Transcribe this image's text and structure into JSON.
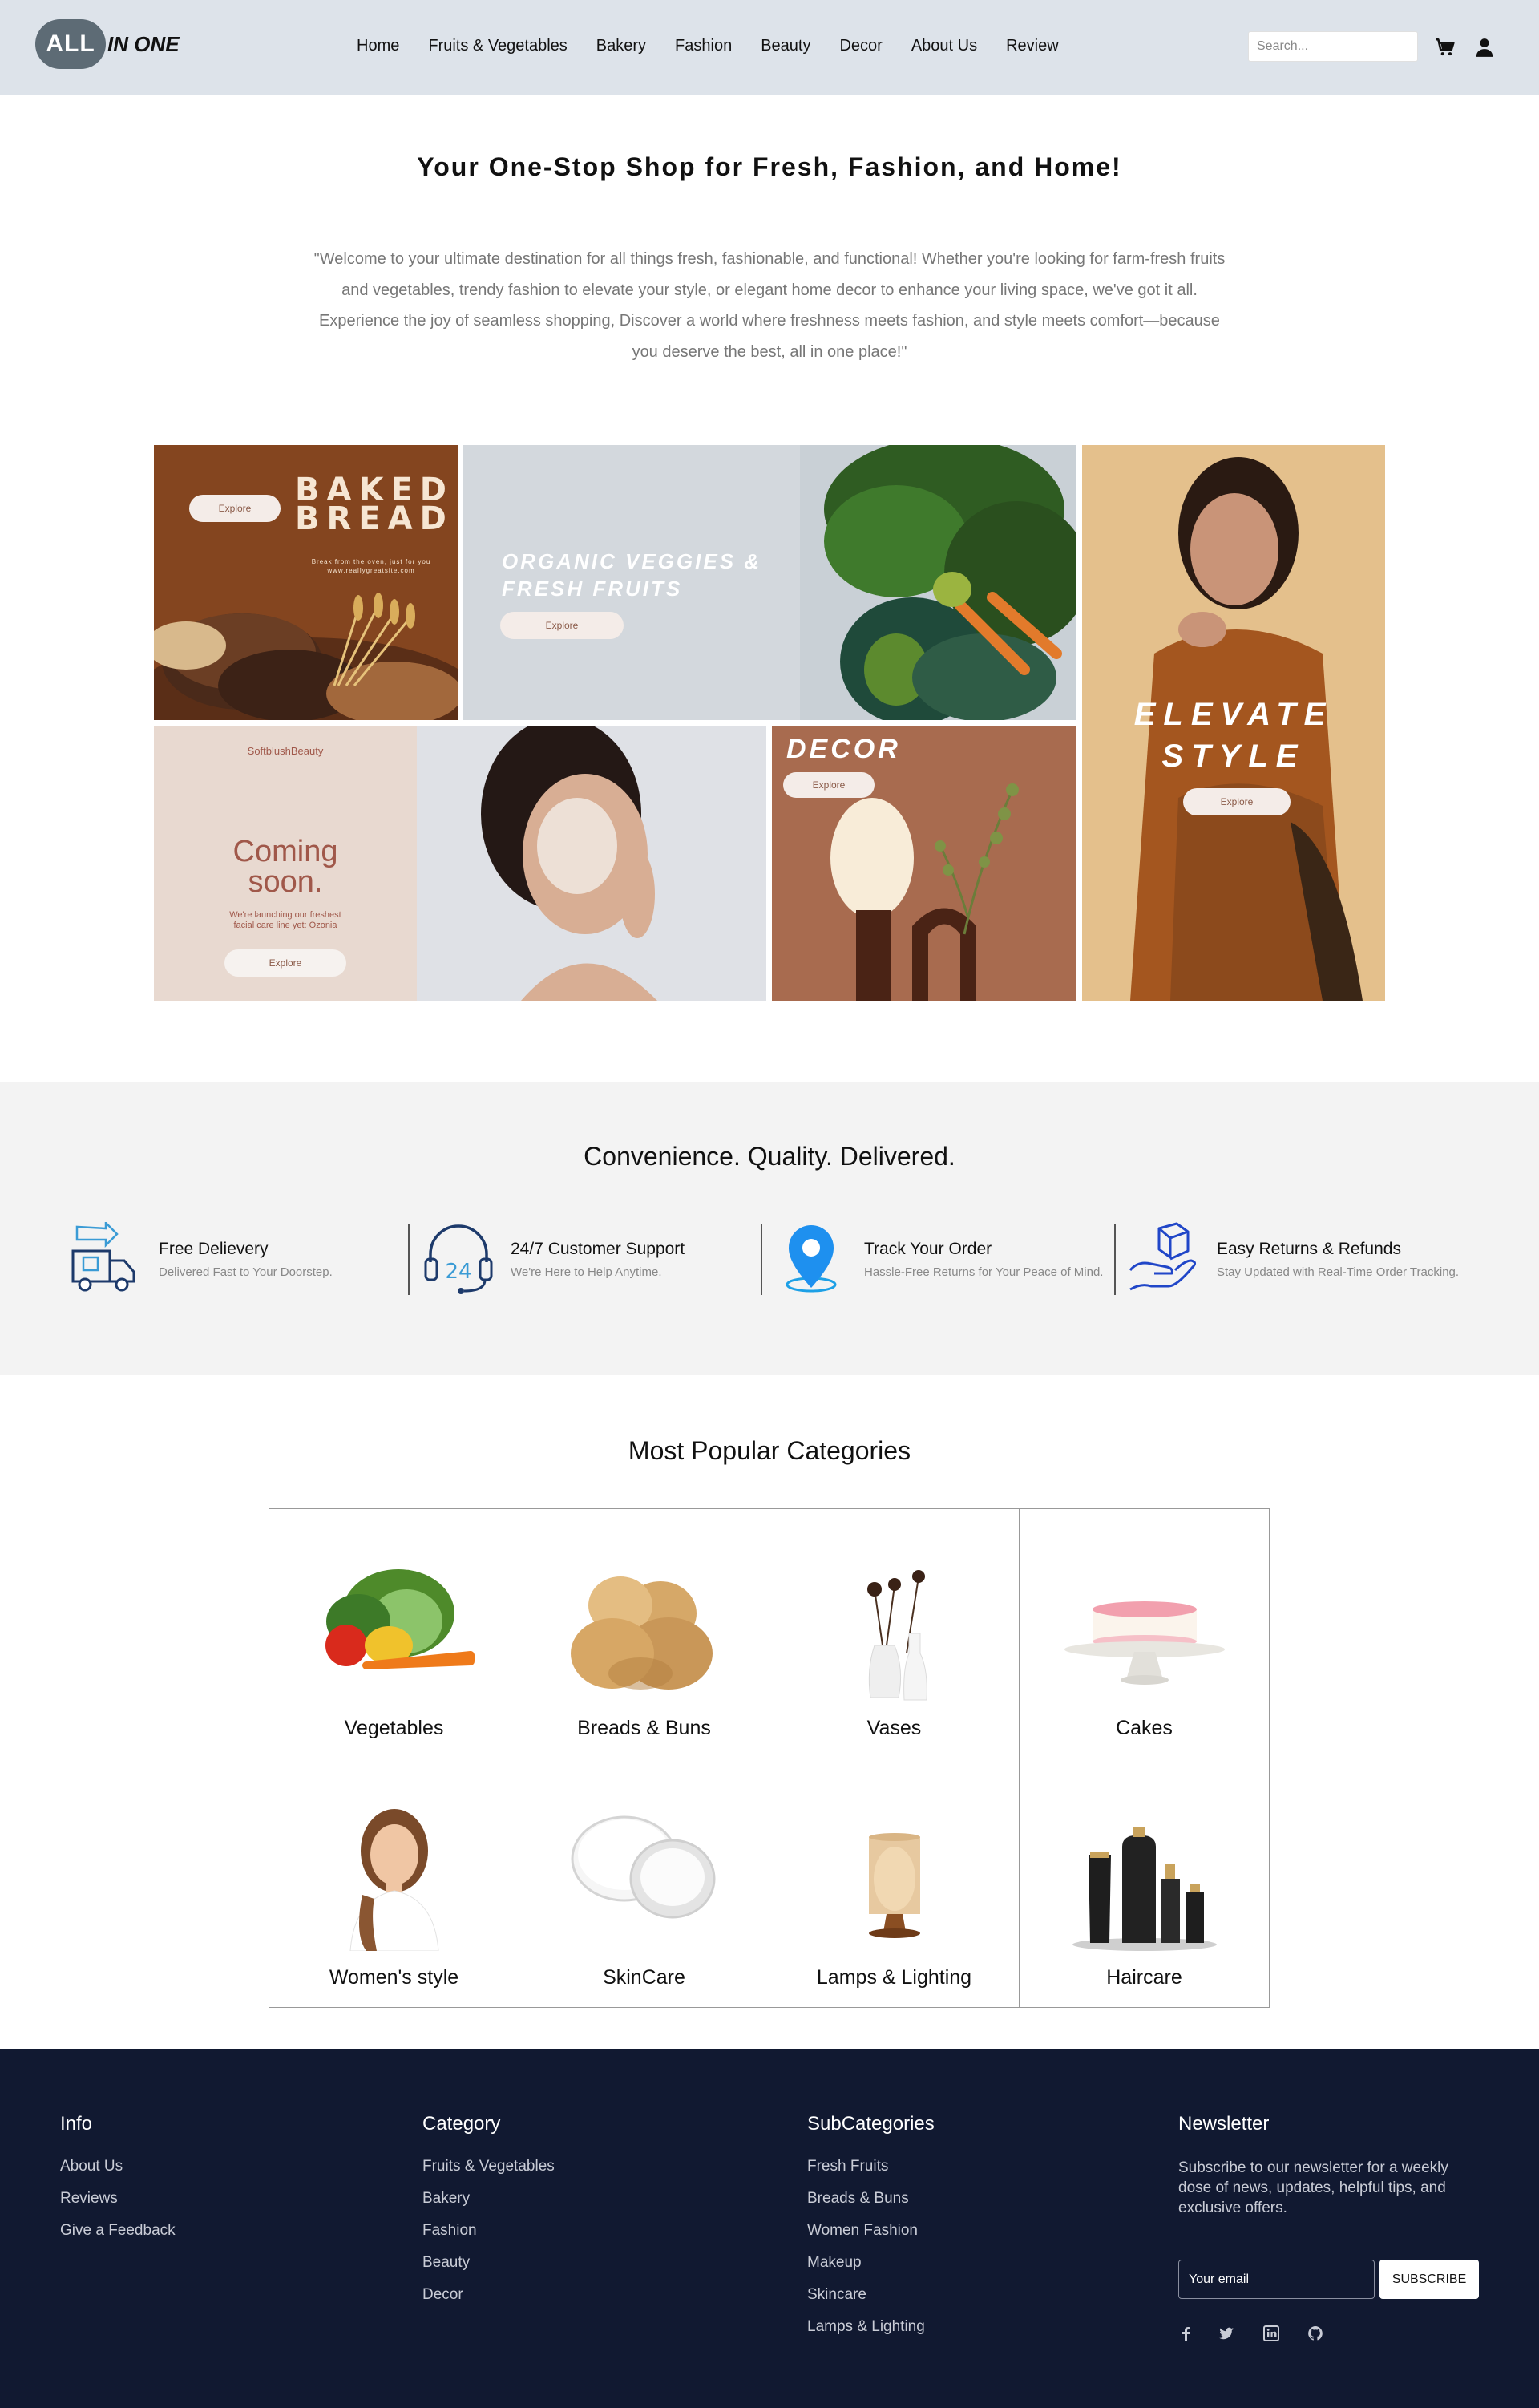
{
  "header": {
    "logo_badge": "ALL",
    "logo_text": "IN ONE",
    "nav": [
      "Home",
      "Fruits & Vegetables",
      "Bakery",
      "Fashion",
      "Beauty",
      "Decor",
      "About Us",
      "Review"
    ],
    "search_placeholder": "Search..."
  },
  "hero": {
    "title": "Your One-Stop Shop for Fresh, Fashion, and Home!",
    "description": "\"Welcome to your ultimate destination for all things fresh, fashionable, and functional! Whether you're looking for farm-fresh fruits and vegetables, trendy fashion to elevate your style, or elegant home decor to enhance your living space, we've got it all. Experience the joy of seamless shopping, Discover a world where freshness meets fashion, and style meets comfort—because you deserve the best, all in one place!\""
  },
  "banners": {
    "bread": {
      "title1": "BAKED",
      "title2": "BREAD",
      "tagline": "Break from the oven, just for you",
      "site": "www.reallygreatsite.com",
      "button": "Explore"
    },
    "veggies": {
      "title1": "ORGANIC VEGGIES &",
      "title2": "FRESH FRUITS",
      "button": "Explore"
    },
    "beauty": {
      "brand": "SoftblushBeauty",
      "title1": "Coming",
      "title2": "soon.",
      "subtitle1": "We're launching our freshest",
      "subtitle2": "facial care line yet: Ozonia",
      "button": "Explore"
    },
    "decor": {
      "title": "DECOR",
      "button": "Explore"
    },
    "style": {
      "title1": "ELEVATE",
      "title2": "STYLE",
      "button": "Explore"
    }
  },
  "features": {
    "title": "Convenience.  Quality.  Delivered.",
    "items": [
      {
        "title": "Free Delievery",
        "desc": "Delivered Fast to Your Doorstep.",
        "icon": "delivery-truck-icon"
      },
      {
        "title": "24/7 Customer Support",
        "desc": "We're Here to Help Anytime.",
        "icon": "headset-24-icon"
      },
      {
        "title": "Track Your Order",
        "desc": "Hassle-Free Returns for Your Peace of Mind.",
        "icon": "location-pin-icon"
      },
      {
        "title": "Easy Returns & Refunds",
        "desc": "Stay Updated with Real-Time Order Tracking.",
        "icon": "returns-box-hand-icon"
      }
    ],
    "support_badge": "24"
  },
  "categories": {
    "title": "Most Popular Categories",
    "items": [
      "Vegetables",
      "Breads & Buns",
      "Vases",
      "Cakes",
      "Women's style",
      "SkinCare",
      "Lamps & Lighting",
      "Haircare"
    ]
  },
  "footer": {
    "info": {
      "title": "Info",
      "links": [
        "About Us",
        "Reviews",
        "Give a Feedback"
      ]
    },
    "category": {
      "title": "Category",
      "links": [
        "Fruits & Vegetables",
        "Bakery",
        "Fashion",
        "Beauty",
        "Decor"
      ]
    },
    "subcategories": {
      "title": "SubCategories",
      "links": [
        "Fresh Fruits",
        "Breads & Buns",
        "Women Fashion",
        "Makeup",
        "Skincare",
        "Lamps & Lighting"
      ]
    },
    "newsletter": {
      "title": "Newsletter",
      "text": "Subscribe to our newsletter for a weekly dose of news, updates, helpful tips, and exclusive offers.",
      "email_placeholder": "Your email",
      "button": "SUBSCRIBE"
    }
  }
}
